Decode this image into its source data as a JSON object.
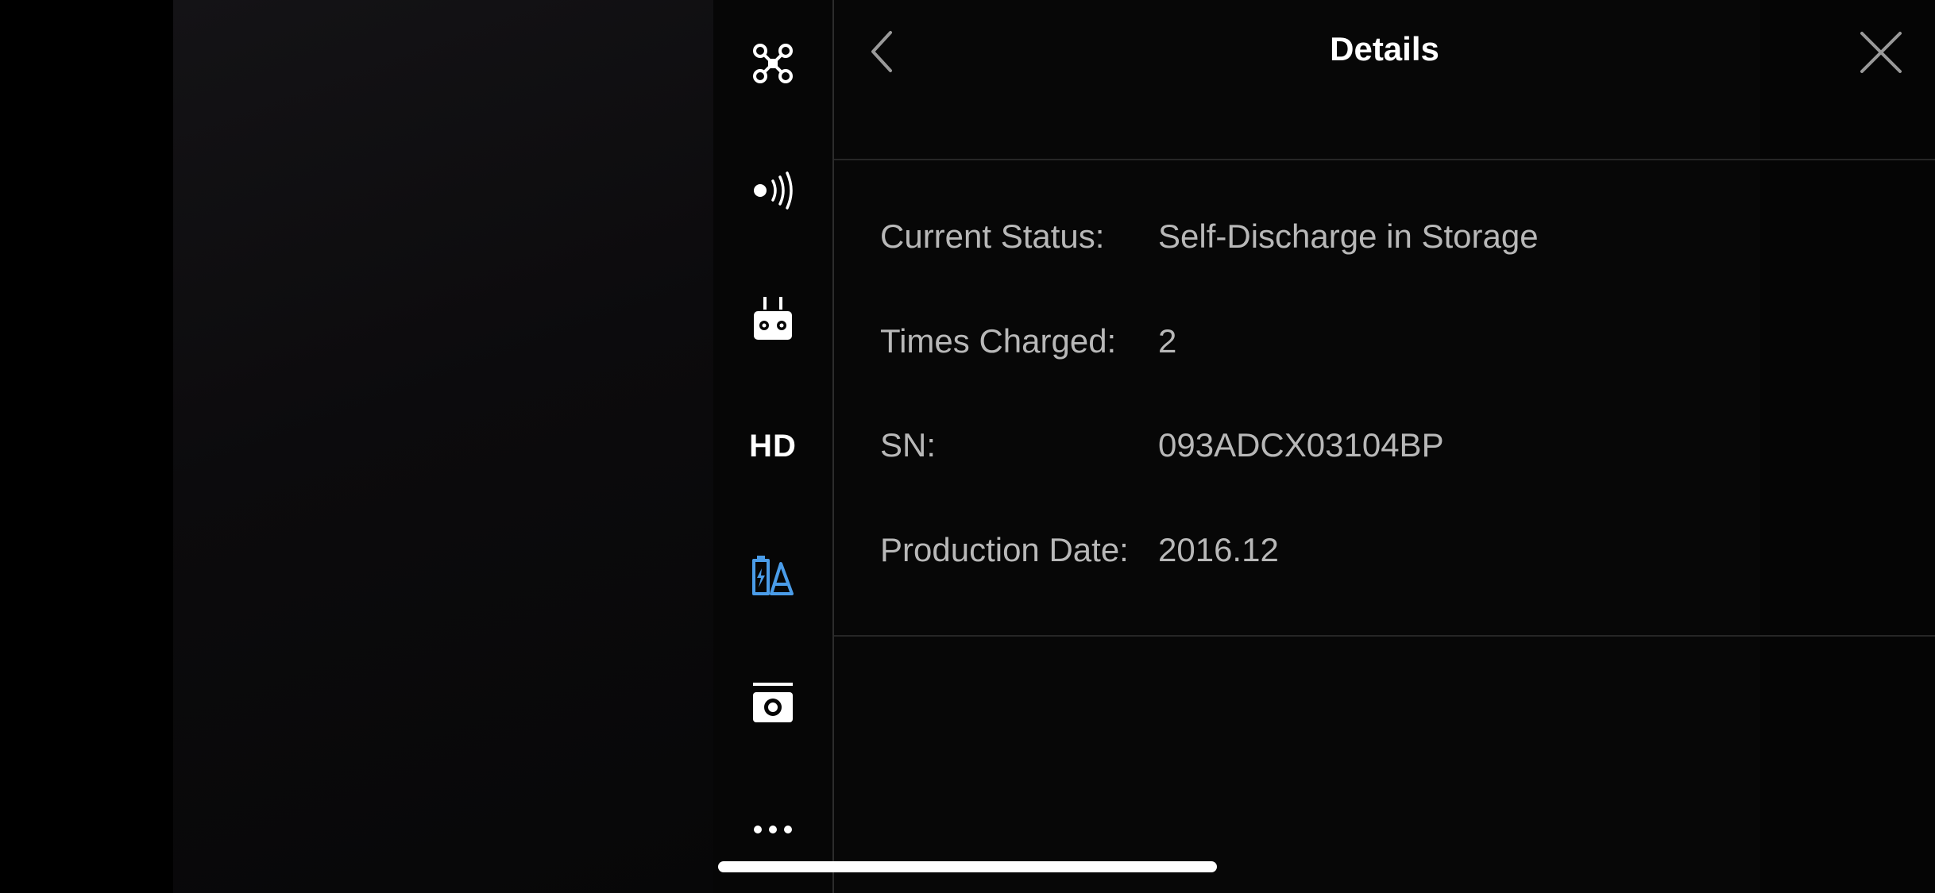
{
  "panel": {
    "title": "Details",
    "back_icon": "chevron-left-icon",
    "close_icon": "close-icon"
  },
  "sidebar": {
    "items": [
      {
        "icon": "aircraft-icon",
        "active": false
      },
      {
        "icon": "signal-icon",
        "active": false
      },
      {
        "icon": "remote-controller-icon",
        "active": false
      },
      {
        "icon": "hd-icon",
        "label": "HD",
        "active": false
      },
      {
        "icon": "battery-icon",
        "active": true
      },
      {
        "icon": "camera-icon",
        "active": false
      },
      {
        "icon": "more-icon",
        "active": false
      }
    ]
  },
  "details": {
    "rows": [
      {
        "label": "Current Status:",
        "value": "Self-Discharge in Storage"
      },
      {
        "label": "Times Charged:",
        "value": "2"
      },
      {
        "label": "SN:",
        "value": "093ADCX03104BP"
      },
      {
        "label": "Production Date:",
        "value": "2016.12"
      }
    ]
  },
  "colors": {
    "accent": "#4a9ce8",
    "text_primary": "#ffffff",
    "text_secondary": "#b8b8b8",
    "background": "#000000"
  }
}
